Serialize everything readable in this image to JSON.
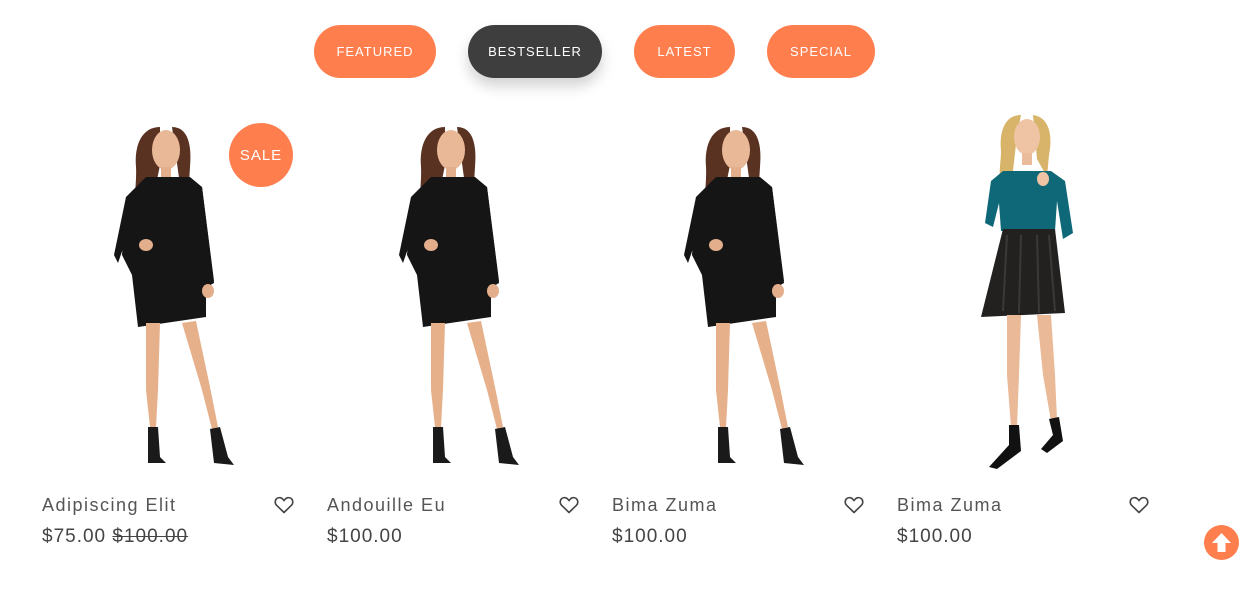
{
  "tabs": [
    {
      "label": "FEATURED",
      "active": false
    },
    {
      "label": "BESTSELLER",
      "active": true
    },
    {
      "label": "LATEST",
      "active": false
    },
    {
      "label": "SPECIAL",
      "active": false
    }
  ],
  "products": [
    {
      "name": "Adipiscing Elit",
      "price": "$75.00",
      "old_price": "$100.00",
      "badge": "SALE",
      "image": "black-dress-model"
    },
    {
      "name": "Andouille Eu",
      "price": "$100.00",
      "image": "black-dress-model"
    },
    {
      "name": "Bima Zuma",
      "price": "$100.00",
      "image": "black-dress-model"
    },
    {
      "name": "Bima Zuma",
      "price": "$100.00",
      "image": "teal-top-leather-skirt-model"
    }
  ],
  "icons": {
    "wishlist": "heart-icon",
    "scroll_top": "arrow-up-circle-icon"
  },
  "colors": {
    "accent": "#ff7e4e",
    "active_tab": "#3e3e3e"
  }
}
